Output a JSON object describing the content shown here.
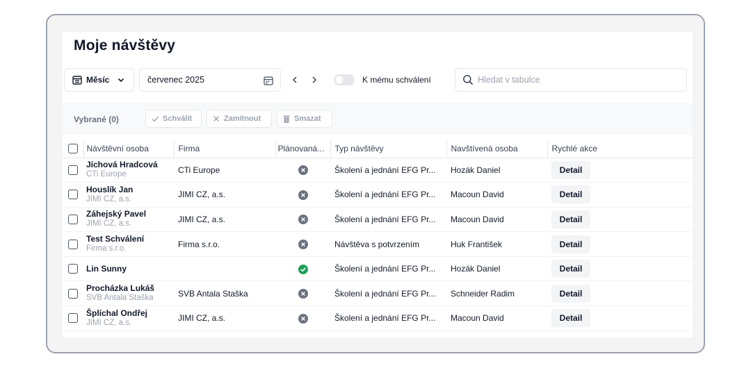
{
  "page": {
    "title": "Moje návštěvy"
  },
  "toolbar": {
    "period_label": "Měsíc",
    "date_value": "červenec 2025",
    "toggle_label": "K mému schválení",
    "toggle_on": false,
    "search_placeholder": "Hledat v tabulce"
  },
  "selection": {
    "label": "Vybrané (0)",
    "approve_label": "Schválit",
    "reject_label": "Zamítnout",
    "delete_label": "Smazat"
  },
  "table": {
    "columns": [
      "Návštěvní osoba",
      "Firma",
      "Plánovaná...",
      "Typ návštěvy",
      "Navštívená osoba",
      "Rychlé akce"
    ],
    "rows": [
      {
        "name": "Jíchová Hradcová",
        "sub": "CTi Europe",
        "company": "CTi Europe",
        "status": "rejected",
        "type": "Školení a jednání EFG Pr...",
        "host": "Hozák Daniel",
        "action": "Detail"
      },
      {
        "name": "Houslík Jan",
        "sub": "JIMI CZ, a.s.",
        "company": "JIMI CZ, a.s.",
        "status": "rejected",
        "type": "Školení a jednání EFG Pr...",
        "host": "Macoun David",
        "action": "Detail"
      },
      {
        "name": "Záhejský Pavel",
        "sub": "JIMI CZ, a.s.",
        "company": "JIMI CZ, a.s.",
        "status": "rejected",
        "type": "Školení a jednání EFG Pr...",
        "host": "Macoun David",
        "action": "Detail"
      },
      {
        "name": "Test Schválení",
        "sub": "Firma s.r.o.",
        "company": "Firma s.r.o.",
        "status": "rejected",
        "type": "Návštěva s potvrzením",
        "host": "Huk František",
        "action": "Detail"
      },
      {
        "name": "Lin Sunny",
        "sub": "",
        "company": "",
        "status": "approved",
        "type": "Školení a jednání EFG Pr...",
        "host": "Hozák Daniel",
        "action": "Detail"
      },
      {
        "name": "Procházka Lukáš",
        "sub": "SVB Antala Staška",
        "company": "SVB Antala Staška",
        "status": "rejected",
        "type": "Školení a jednání EFG Pr...",
        "host": "Schneider Radim",
        "action": "Detail"
      },
      {
        "name": "Šplíchal Ondřej",
        "sub": "JIMI CZ, a.s.",
        "company": "JIMI CZ, a.s.",
        "status": "rejected",
        "type": "Školení a jednání EFG Pr...",
        "host": "Macoun David",
        "action": "Detail"
      }
    ]
  },
  "colors": {
    "status_rejected": "#6b7280",
    "status_approved": "#22a05a",
    "border": "#e5e7eb"
  },
  "icons": {
    "period": "calendar-grid-icon",
    "date_picker": "calendar-icon",
    "prev": "chevron-left-icon",
    "next": "chevron-right-icon",
    "search": "search-icon",
    "approve": "check-icon",
    "reject": "close-icon",
    "delete": "trash-icon",
    "status_rejected": "x-circle-icon",
    "status_approved": "check-circle-icon"
  }
}
